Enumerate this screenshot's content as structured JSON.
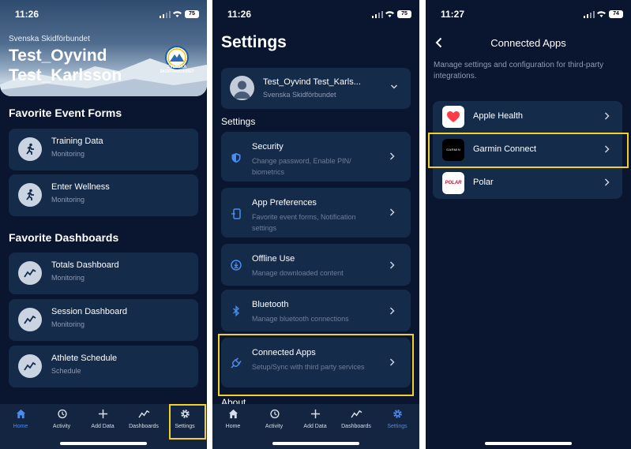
{
  "colors": {
    "background": "#0a1630",
    "card": "#152b4a",
    "accent": "#4a8cf0",
    "highlight": "#f2d027"
  },
  "phone1": {
    "status": {
      "time": "11:26",
      "battery": "75"
    },
    "header": {
      "org": "Svenska Skidförbundet",
      "name": "Test_Oyvind Test_Karlsson",
      "logo_text": "SVENSKA SKIDFÖRBUNDET"
    },
    "favorite_forms": {
      "title": "Favorite Event Forms",
      "items": [
        {
          "title": "Training Data",
          "subtitle": "Monitoring",
          "icon": "runner-icon"
        },
        {
          "title": "Enter Wellness",
          "subtitle": "Monitoring",
          "icon": "runner-icon"
        }
      ]
    },
    "favorite_dashboards": {
      "title": "Favorite Dashboards",
      "items": [
        {
          "title": "Totals Dashboard",
          "subtitle": "Monitoring",
          "icon": "trend-icon"
        },
        {
          "title": "Session Dashboard",
          "subtitle": "Monitoring",
          "icon": "trend-icon"
        },
        {
          "title": "Athlete Schedule",
          "subtitle": "Schedule",
          "icon": "trend-icon"
        }
      ]
    },
    "tabbar": [
      "Home",
      "Activity",
      "Add Data",
      "Dashboards",
      "Settings"
    ],
    "active_tab": "Home"
  },
  "phone2": {
    "status": {
      "time": "11:26",
      "battery": "75"
    },
    "title": "Settings",
    "profile": {
      "name": "Test_Oyvind Test_Karls...",
      "org": "Svenska Skidförbundet"
    },
    "section": "Settings",
    "items": [
      {
        "title": "Security",
        "subtitle": "Change password, Enable PIN/ biometrics",
        "icon": "shield-icon"
      },
      {
        "title": "App Preferences",
        "subtitle": "Favorite event forms, Notification settings",
        "icon": "phone-icon"
      },
      {
        "title": "Offline Use",
        "subtitle": "Manage downloaded content",
        "icon": "download-icon"
      },
      {
        "title": "Bluetooth",
        "subtitle": "Manage bluetooth connections",
        "icon": "bluetooth-icon"
      },
      {
        "title": "Connected Apps",
        "subtitle": "Setup/Sync with third party services",
        "icon": "plug-icon"
      }
    ],
    "next_section": "About",
    "tabbar": [
      "Home",
      "Activity",
      "Add Data",
      "Dashboards",
      "Settings"
    ],
    "active_tab": "Settings"
  },
  "phone3": {
    "status": {
      "time": "11:27",
      "battery": "74"
    },
    "title": "Connected Apps",
    "description": "Manage settings and configuration for third-party integrations.",
    "apps": [
      {
        "name": "Apple Health",
        "icon": "heart-icon",
        "logo_text": ""
      },
      {
        "name": "Garmin Connect",
        "icon": "garmin-logo",
        "logo_text": "GARMIN"
      },
      {
        "name": "Polar",
        "icon": "polar-logo",
        "logo_text": "POLAR"
      }
    ]
  }
}
